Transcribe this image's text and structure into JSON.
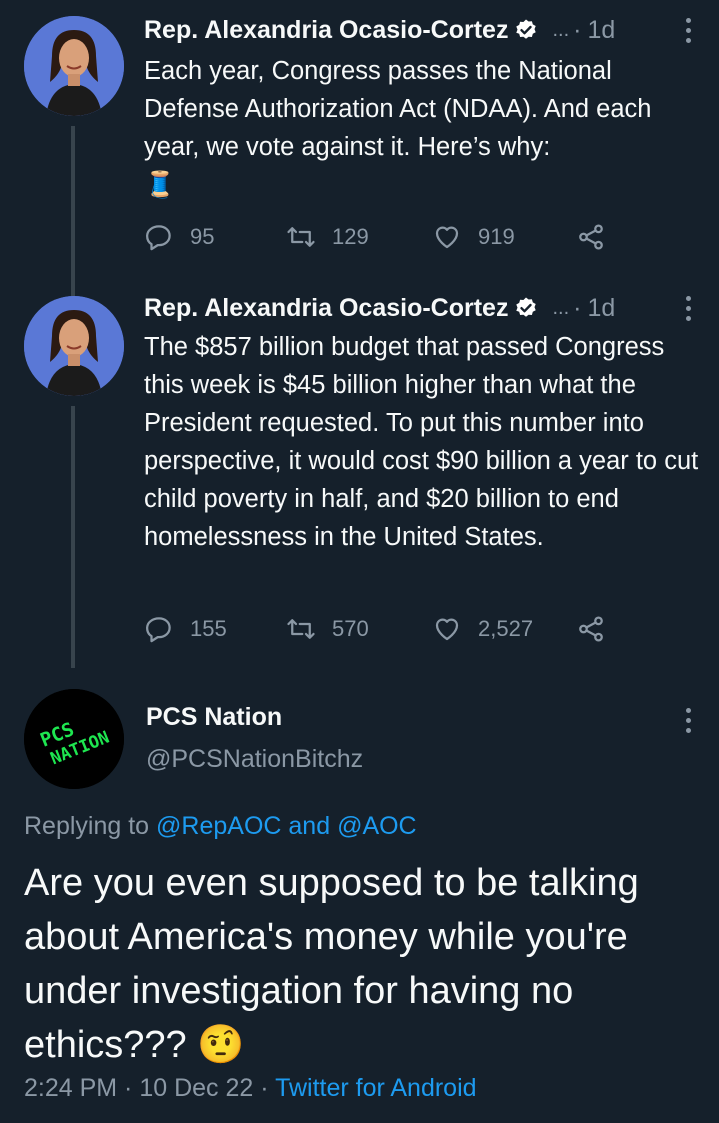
{
  "thread": [
    {
      "author_name": "Rep. Alexandria Ocasio-Cortez",
      "ellipsis": "...",
      "dot": "·",
      "time": "1d",
      "text": "Each year, Congress passes the National Defense Authorization Act (NDAA). And each year, we vote against it. Here’s why:",
      "emoji": "🧵",
      "stats": {
        "replies": "95",
        "retweets": "129",
        "likes": "919"
      }
    },
    {
      "author_name": "Rep. Alexandria Ocasio-Cortez",
      "ellipsis": "...",
      "dot": "·",
      "time": "1d",
      "text": "The $857 billion budget that passed Congress this week is $45 billion higher than what the President requested. To put this number into perspective, it would cost $90 billion a year to cut child poverty in half, and $20 billion to end homelessness in the United States.",
      "stats": {
        "replies": "155",
        "retweets": "570",
        "likes": "2,527"
      }
    }
  ],
  "reply": {
    "avatar_text_1": "PCS",
    "avatar_text_2": "NATION",
    "author_name": "PCS Nation",
    "handle": "@PCSNationBitchz",
    "replying_prefix": "Replying to ",
    "replying_to_1": "@RepAOC",
    "replying_and": " and ",
    "replying_to_2": "@AOC",
    "text": "Are you even supposed to be talking about America's money while you're under investigation for having no ethics???",
    "emoji": "🤨",
    "footer_time": "2:24 PM · 10 Dec 22 · ",
    "footer_client": "Twitter for Android"
  },
  "colors": {
    "background": "#15202b",
    "muted": "#8b98a5",
    "link": "#1d9bf0",
    "thread_line": "#38444d",
    "avatar_accent": "#1ee650"
  }
}
